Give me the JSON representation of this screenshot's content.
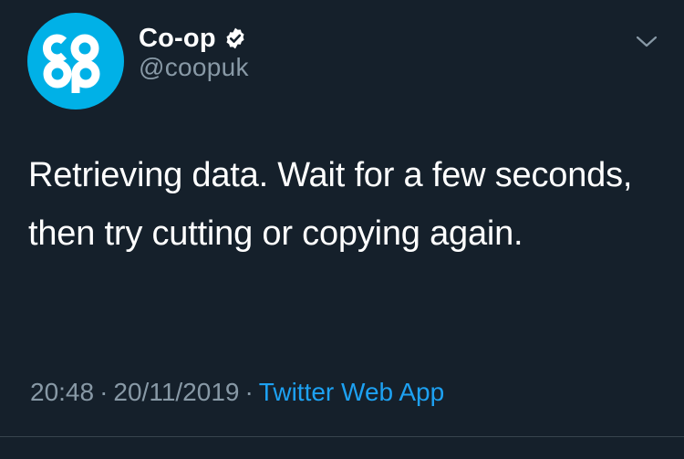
{
  "tweet": {
    "author": {
      "display_name": "Co-op",
      "handle": "@coopuk",
      "avatar_text": "co op",
      "verified": true,
      "avatar_icon": "co-op-logo",
      "verified_icon": "verified-badge-icon"
    },
    "text": "Retrieving data. Wait for a few seconds, then try cutting or copying again.",
    "time": "20:48",
    "separator": "·",
    "date": "20/11/2019",
    "source": "Twitter Web App",
    "menu_icon": "chevron-down-icon"
  },
  "colors": {
    "background": "#15202b",
    "avatar_bg": "#00b1e7",
    "secondary_text": "#8899a6",
    "link": "#1da1f2",
    "divider": "#38444d"
  }
}
